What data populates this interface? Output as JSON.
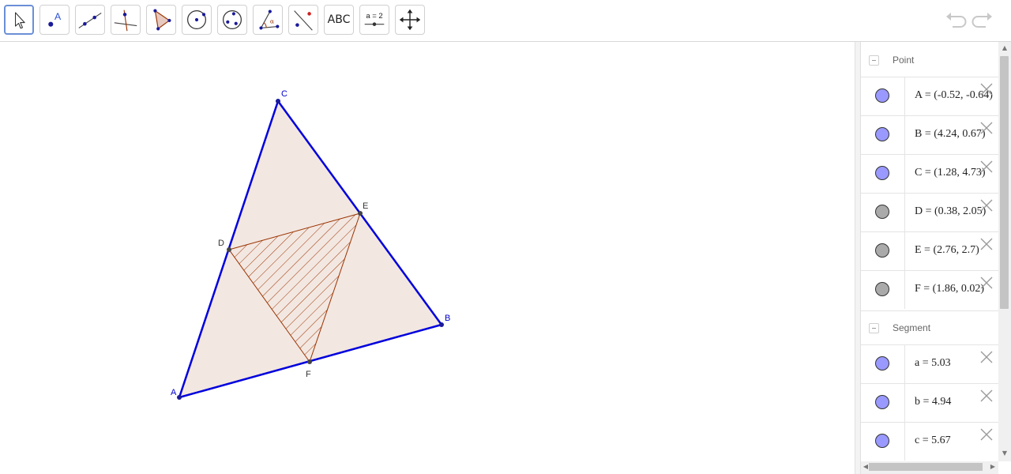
{
  "toolbar": {
    "tools": [
      {
        "name": "move-tool",
        "active": true
      },
      {
        "name": "point-tool"
      },
      {
        "name": "line-tool"
      },
      {
        "name": "perpendicular-line-tool"
      },
      {
        "name": "polygon-tool"
      },
      {
        "name": "circle-tool"
      },
      {
        "name": "conic-tool"
      },
      {
        "name": "angle-tool"
      },
      {
        "name": "reflect-tool"
      },
      {
        "name": "text-tool",
        "label": "ABC"
      },
      {
        "name": "slider-tool",
        "label": "a = 2"
      },
      {
        "name": "move-graphics-view-tool"
      }
    ],
    "undo_icon": "undo-icon",
    "redo_icon": "redo-icon"
  },
  "construction": {
    "points": {
      "A": {
        "label": "A"
      },
      "B": {
        "label": "B"
      },
      "C": {
        "label": "C"
      },
      "D": {
        "label": "D"
      },
      "E": {
        "label": "E"
      },
      "F": {
        "label": "F"
      }
    },
    "colors": {
      "segment": "#0000dd",
      "triangle_fill": "#f3e7e1",
      "hatch": "#993300",
      "free_point": "#1a1a9a",
      "dependent_point": "#333333"
    }
  },
  "algebra": {
    "groups": [
      {
        "label": "Point",
        "items": [
          {
            "def": "A = (-0.52, -0.64)",
            "marble": "#9999ff"
          },
          {
            "def": "B = (4.24, 0.67)",
            "marble": "#9999ff"
          },
          {
            "def": "C = (1.28, 4.73)",
            "marble": "#9999ff"
          },
          {
            "def": "D = (0.38, 2.05)",
            "marble": "#aaaaaa"
          },
          {
            "def": "E = (2.76, 2.7)",
            "marble": "#aaaaaa"
          },
          {
            "def": "F = (1.86, 0.02)",
            "marble": "#aaaaaa"
          }
        ]
      },
      {
        "label": "Segment",
        "items": [
          {
            "def": "a = 5.03",
            "marble": "#9999ff"
          },
          {
            "def": "b = 4.94",
            "marble": "#9999ff"
          },
          {
            "def": "c = 5.67",
            "marble": "#9999ff"
          }
        ]
      }
    ]
  }
}
